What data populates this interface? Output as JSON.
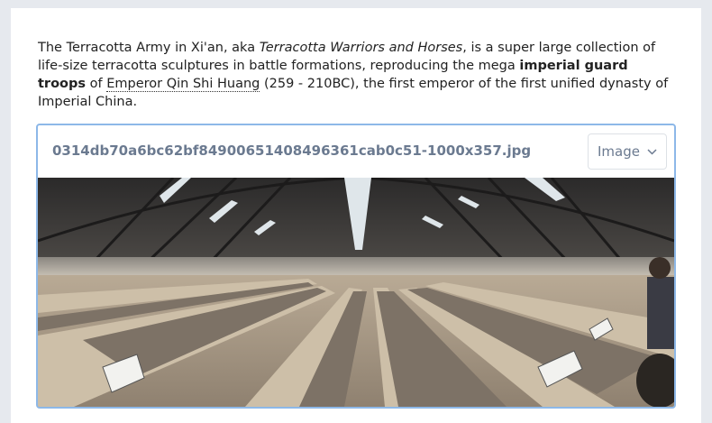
{
  "paragraph": {
    "t1": "The Terracotta Army in Xi'an, aka ",
    "italic": "Terracotta Warriors and Horses",
    "t2": ", is a super large collection of life-size terracotta sculptures in battle formations, reproducing the mega ",
    "bold": "imperial guard troops",
    "t3": " of ",
    "link": "Emperor Qin Shi Huang",
    "t4": " (259 - 210BC), the first emperor of the first unified dynasty of Imperial China."
  },
  "image_block": {
    "filename": "0314db70a6bc62bf84900651408496361cab0c51-1000x357.jpg",
    "type_label": "Image"
  },
  "icons": {
    "dropdown": "chevron-down-icon"
  }
}
